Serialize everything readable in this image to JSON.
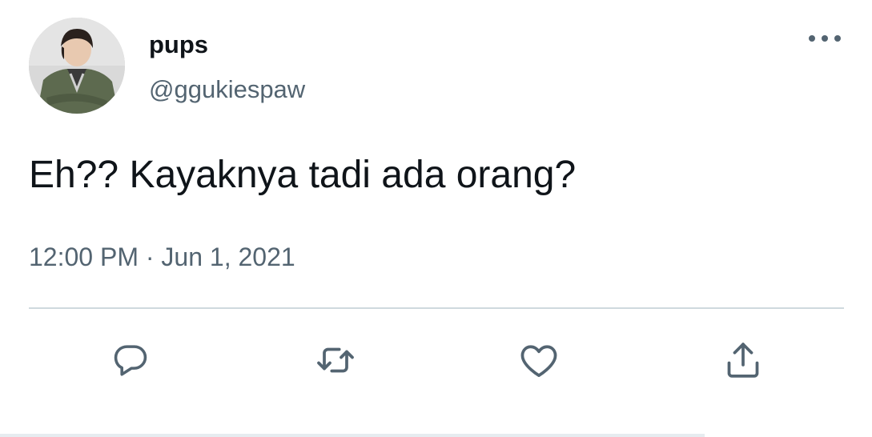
{
  "tweet": {
    "display_name": "pups",
    "handle": "@ggukiespaw",
    "text": "Eh?? Kayaknya tadi ada orang?",
    "timestamp": "12:00 PM · Jun 1, 2021"
  },
  "icons": {
    "more": "more-dots-icon",
    "reply": "reply-bubble-icon",
    "retweet": "retweet-arrows-icon",
    "like": "heart-icon",
    "share": "share-upload-icon"
  },
  "colors": {
    "text_primary": "#0f1419",
    "text_secondary": "#536471",
    "divider": "#cfd9de"
  }
}
